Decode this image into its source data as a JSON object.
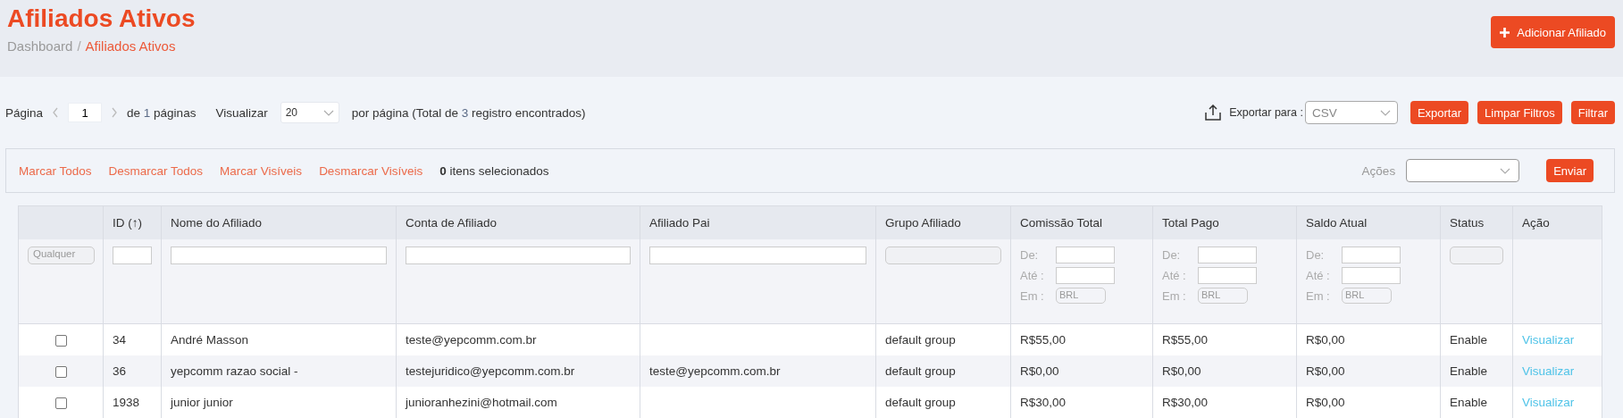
{
  "header": {
    "title": "Afiliados Ativos",
    "breadcrumb_separator": "/",
    "breadcrumb": [
      {
        "label": "Dashboard",
        "current": false
      },
      {
        "label": "Afiliados Ativos",
        "current": true
      }
    ],
    "add_button": "Adicionar Afiliado"
  },
  "pagination": {
    "label": "Página",
    "page": "1",
    "of_text": "de",
    "pages": "1",
    "pages_suffix": "páginas",
    "view_label": "Visualizar",
    "per_page": "20",
    "summary_before": "por página (Total de",
    "total": "3",
    "summary_after": "registro encontrados)"
  },
  "export": {
    "label": "Exportar para :",
    "format": "CSV",
    "buttons": [
      "Exportar",
      "Limpar Filtros",
      "Filtrar"
    ]
  },
  "selection_bar": {
    "links": [
      "Marcar Todos",
      "Desmarcar Todos",
      "Marcar Visíveis",
      "Desmarcar Visíveis"
    ],
    "count": "0",
    "count_suffix": "itens selecionados",
    "actions_label": "Ações",
    "send_button": "Enviar"
  },
  "table": {
    "columns": [
      {
        "filter": {
          "kind": "select",
          "placeholder": "Qualquer"
        }
      },
      {
        "label": "ID (↑)",
        "filter": {
          "kind": "text"
        }
      },
      {
        "label": "Nome do Afiliado",
        "filter": {
          "kind": "text"
        }
      },
      {
        "label": "Conta de Afiliado",
        "filter": {
          "kind": "text"
        }
      },
      {
        "label": "Afiliado Pai",
        "filter": {
          "kind": "text"
        }
      },
      {
        "label": "Grupo Afiliado",
        "filter": {
          "kind": "select"
        }
      },
      {
        "label": "Comissão Total",
        "filter": {
          "kind": "range",
          "from": "De:",
          "to": "Até :",
          "in": "Em :",
          "currency": "BRL"
        }
      },
      {
        "label": "Total Pago",
        "filter": {
          "kind": "range",
          "from": "De:",
          "to": "Até :",
          "in": "Em :",
          "currency": "BRL"
        }
      },
      {
        "label": "Saldo Atual",
        "filter": {
          "kind": "range",
          "from": "De:",
          "to": "Até :",
          "in": "Em :",
          "currency": "BRL"
        }
      },
      {
        "label": "Status",
        "filter": {
          "kind": "select"
        }
      },
      {
        "label": "Ação",
        "filter": {
          "kind": "none"
        }
      }
    ],
    "rows": [
      {
        "checked": false,
        "id": "34",
        "name": "André Masson",
        "account": "teste@yepcomm.com.br",
        "group": "default group",
        "commission": "R$55,00",
        "paid": "R$55,00",
        "balance": "R$0,00",
        "status": "Enable",
        "action": "Visualizar"
      },
      {
        "checked": false,
        "id": "36",
        "name": "yepcomm razao social -",
        "account": "testejuridico@yepcomm.com.br",
        "parent": "teste@yepcomm.com.br",
        "group": "default group",
        "commission": "R$0,00",
        "paid": "R$0,00",
        "balance": "R$0,00",
        "status": "Enable",
        "action": "Visualizar"
      },
      {
        "checked": false,
        "id": "1938",
        "name": "junior junior",
        "account": "junioranhezini@hotmail.com",
        "group": "default group",
        "commission": "R$30,00",
        "paid": "R$30,00",
        "balance": "R$0,00",
        "status": "Enable",
        "action": "Visualizar"
      }
    ]
  }
}
